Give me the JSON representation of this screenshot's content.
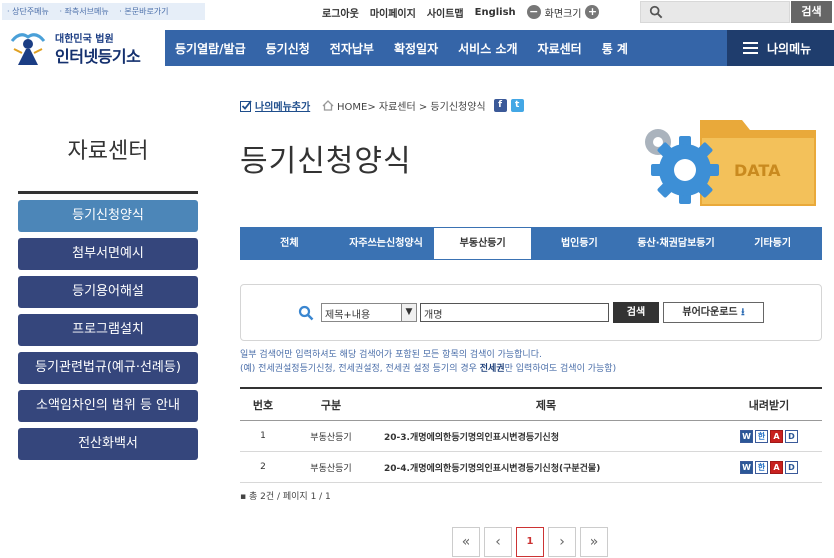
{
  "skip_links": [
    "상단주메뉴",
    "좌측서브메뉴",
    "본문바로가기"
  ],
  "util": {
    "logout": "로그아웃",
    "mypage": "마이페이지",
    "sitemap": "사이트맵",
    "english": "English",
    "zoom_minus": "−",
    "zoom_label": "화면크기",
    "zoom_plus": "+",
    "search_button": "검색",
    "search_placeholder": ""
  },
  "logo": {
    "small": "대한민국 법원",
    "big": "인터넷등기소"
  },
  "gnb": [
    "등기열람/발급",
    "등기신청",
    "전자납부",
    "확정일자",
    "서비스 소개",
    "자료센터",
    "통 계"
  ],
  "my_menu": "나의메뉴",
  "sidebar": {
    "title": "자료센터",
    "items": [
      "등기신청양식",
      "첨부서면예시",
      "등기용어해설",
      "프로그램설치",
      "등기관련법규(예규·선례등)",
      "소액임차인의 범위 등 안내",
      "전산화백서"
    ],
    "active_index": 0
  },
  "breadcrumb": {
    "add_menu": "나의메뉴추가",
    "path": "HOME> 자료센터 > 등기신청양식",
    "facebook": "f",
    "twitter": "t"
  },
  "page_title": "등기신청양식",
  "deco_label": "DATA",
  "tabs": {
    "items": [
      "전체",
      "자주쓰는신청양식",
      "부동산등기",
      "법인등기",
      "동산·채권담보등기",
      "기타등기"
    ],
    "active_index": 2
  },
  "search": {
    "select_value": "제목+내용",
    "keyword_value": "개명",
    "search_button": "검색",
    "viewer_button": "뷰어다운로드"
  },
  "notes": {
    "line1": "일부 검색어만 입력하셔도 해당 검색어가 포함된 모든 항목의 검색이 가능합니다.",
    "line2_prefix": "(예) 전세권설정등기신청, 전세권설정, 전세권 설정 등기의 경우 ",
    "line2_bold": "전세권",
    "line2_suffix": "만 입력하여도 검색이 가능함)"
  },
  "table": {
    "headers": [
      "번호",
      "구분",
      "제목",
      "내려받기"
    ],
    "rows": [
      {
        "no": "1",
        "category": "부동산등기",
        "title": "20-3.개명에의한등기명의인표시변경등기신청"
      },
      {
        "no": "2",
        "category": "부동산등기",
        "title": "20-4.개명에의한등기명의인표시변경등기신청(구분건물)"
      }
    ],
    "file_icons": [
      "W",
      "한",
      "A",
      "D"
    ]
  },
  "count": "총 2건 / 페이지 1 / 1",
  "pagination": {
    "first": "«",
    "prev": "‹",
    "current": "1",
    "next": "›",
    "last": "»"
  },
  "colors": {
    "gnb": "#3565a8",
    "sidebar": "#35467c",
    "sidebar_active": "#4c86b8",
    "tab": "#3a72b3"
  }
}
